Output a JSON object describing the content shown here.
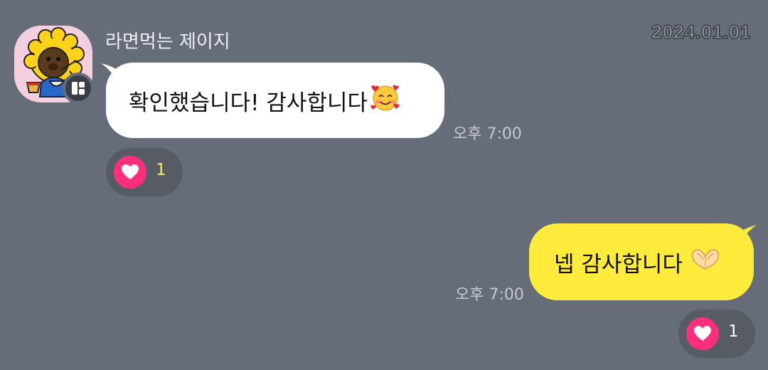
{
  "date": "2024.01.01",
  "incoming": {
    "sender_name": "라면먹는 제이지",
    "message": "확인했습니다! 감사합니다",
    "emoji_icon": "smiling-face-with-hearts-icon",
    "time": "오후 7:00",
    "reaction": {
      "icon": "heart-icon",
      "count": "1",
      "count_color": "#ffe84a"
    }
  },
  "outgoing": {
    "message": "넵 감사합니다",
    "emoji_icon": "heart-hands-icon",
    "time": "오후 7:00",
    "reaction": {
      "icon": "heart-icon",
      "count": "1",
      "count_color": "#ffffff"
    }
  },
  "colors": {
    "background": "#666c78",
    "incoming_bubble": "#ffffff",
    "outgoing_bubble": "#ffeb3b",
    "heart": "#ff2f7d"
  }
}
